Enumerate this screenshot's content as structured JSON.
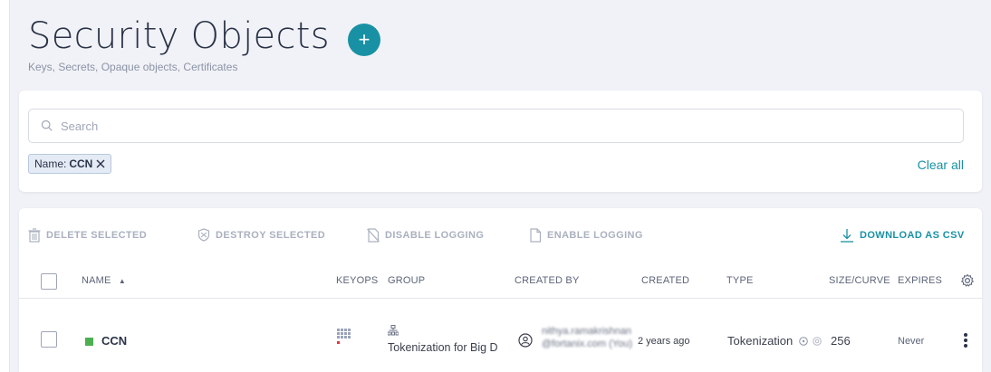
{
  "header": {
    "title": "Security Objects",
    "subtitle": "Keys, Secrets, Opaque objects, Certificates",
    "add_label": "+"
  },
  "search": {
    "placeholder": "Search",
    "filter_chip": {
      "key": "Name:",
      "value": "CCN"
    },
    "clear_all": "Clear all"
  },
  "toolbar": {
    "delete_selected": "DELETE SELECTED",
    "destroy_selected": "DESTROY SELECTED",
    "disable_logging": "DISABLE LOGGING",
    "enable_logging": "ENABLE LOGGING",
    "download_csv": "DOWNLOAD AS CSV"
  },
  "table": {
    "columns": {
      "name": "NAME",
      "keyops": "KEYOPS",
      "group": "GROUP",
      "created_by": "CREATED BY",
      "created": "CREATED",
      "type": "TYPE",
      "size_curve": "SIZE/CURVE",
      "expires": "EXPIRES"
    },
    "rows": [
      {
        "name": "CCN",
        "group": "Tokenization for Big D",
        "created_by": "nithya.ramakrishnan@fortanix.com (You)",
        "created": "2 years ago",
        "type": "Tokenization",
        "size": "256",
        "expires": "Never"
      }
    ]
  },
  "colors": {
    "accent": "#1891a4",
    "name_status": "#4caf50",
    "keyops_red": "#e0383f"
  }
}
